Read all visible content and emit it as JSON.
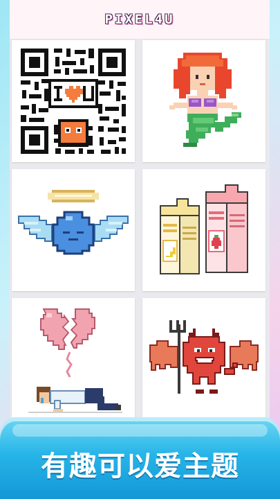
{
  "app": {
    "logo": "PIXEL4U"
  },
  "gallery": {
    "items": [
      {
        "name": "qr-code-i-love-u"
      },
      {
        "name": "mermaid"
      },
      {
        "name": "angel-slime"
      },
      {
        "name": "milk-cartons"
      },
      {
        "name": "broken-heart-person"
      },
      {
        "name": "red-devil"
      }
    ]
  },
  "banner": {
    "text": "有趣可以爱主题"
  },
  "colors": {
    "banner": "#1ea8e3",
    "header_bg": "#fff4f8",
    "heart": "#f47c3c",
    "mermaid_hair": "#e8472d",
    "mermaid_tail": "#3fae5a",
    "slime": "#4a8fe0",
    "devil": "#e0463c"
  }
}
